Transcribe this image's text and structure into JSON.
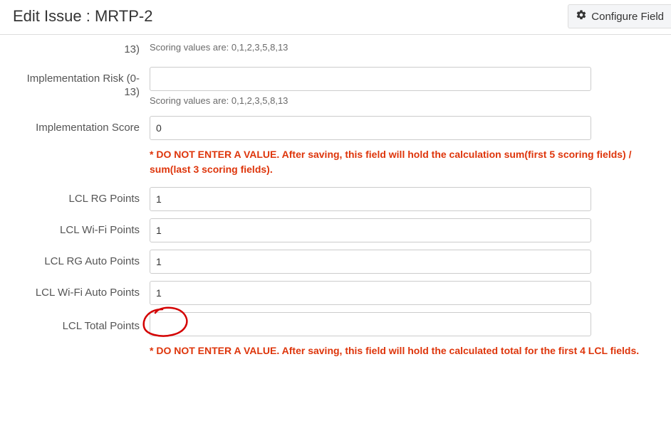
{
  "header": {
    "title": "Edit Issue : MRTP-2",
    "configure_label": "Configure Field"
  },
  "fields": {
    "partial_top": {
      "label_line2": "13)",
      "hint": "Scoring values are: 0,1,2,3,5,8,13"
    },
    "impl_risk": {
      "label": "Implementation Risk (0-13)",
      "value": "",
      "hint": "Scoring values are: 0,1,2,3,5,8,13"
    },
    "impl_score": {
      "label": "Implementation Score",
      "value": "0",
      "warn": "* DO NOT ENTER A VALUE. After saving, this field will hold the calculation sum(first 5 scoring fields) / sum(last 3 scoring fields)."
    },
    "lcl_rg": {
      "label": "LCL RG Points",
      "value": "1"
    },
    "lcl_wifi": {
      "label": "LCL Wi-Fi Points",
      "value": "1"
    },
    "lcl_rg_auto": {
      "label": "LCL RG Auto Points",
      "value": "1"
    },
    "lcl_wifi_auto": {
      "label": "LCL Wi-Fi Auto Points",
      "value": "1"
    },
    "lcl_total": {
      "label": "LCL Total Points",
      "value": "",
      "warn": "* DO NOT ENTER A VALUE. After saving, this field will hold the calculated total for the first 4 LCL fields."
    }
  }
}
